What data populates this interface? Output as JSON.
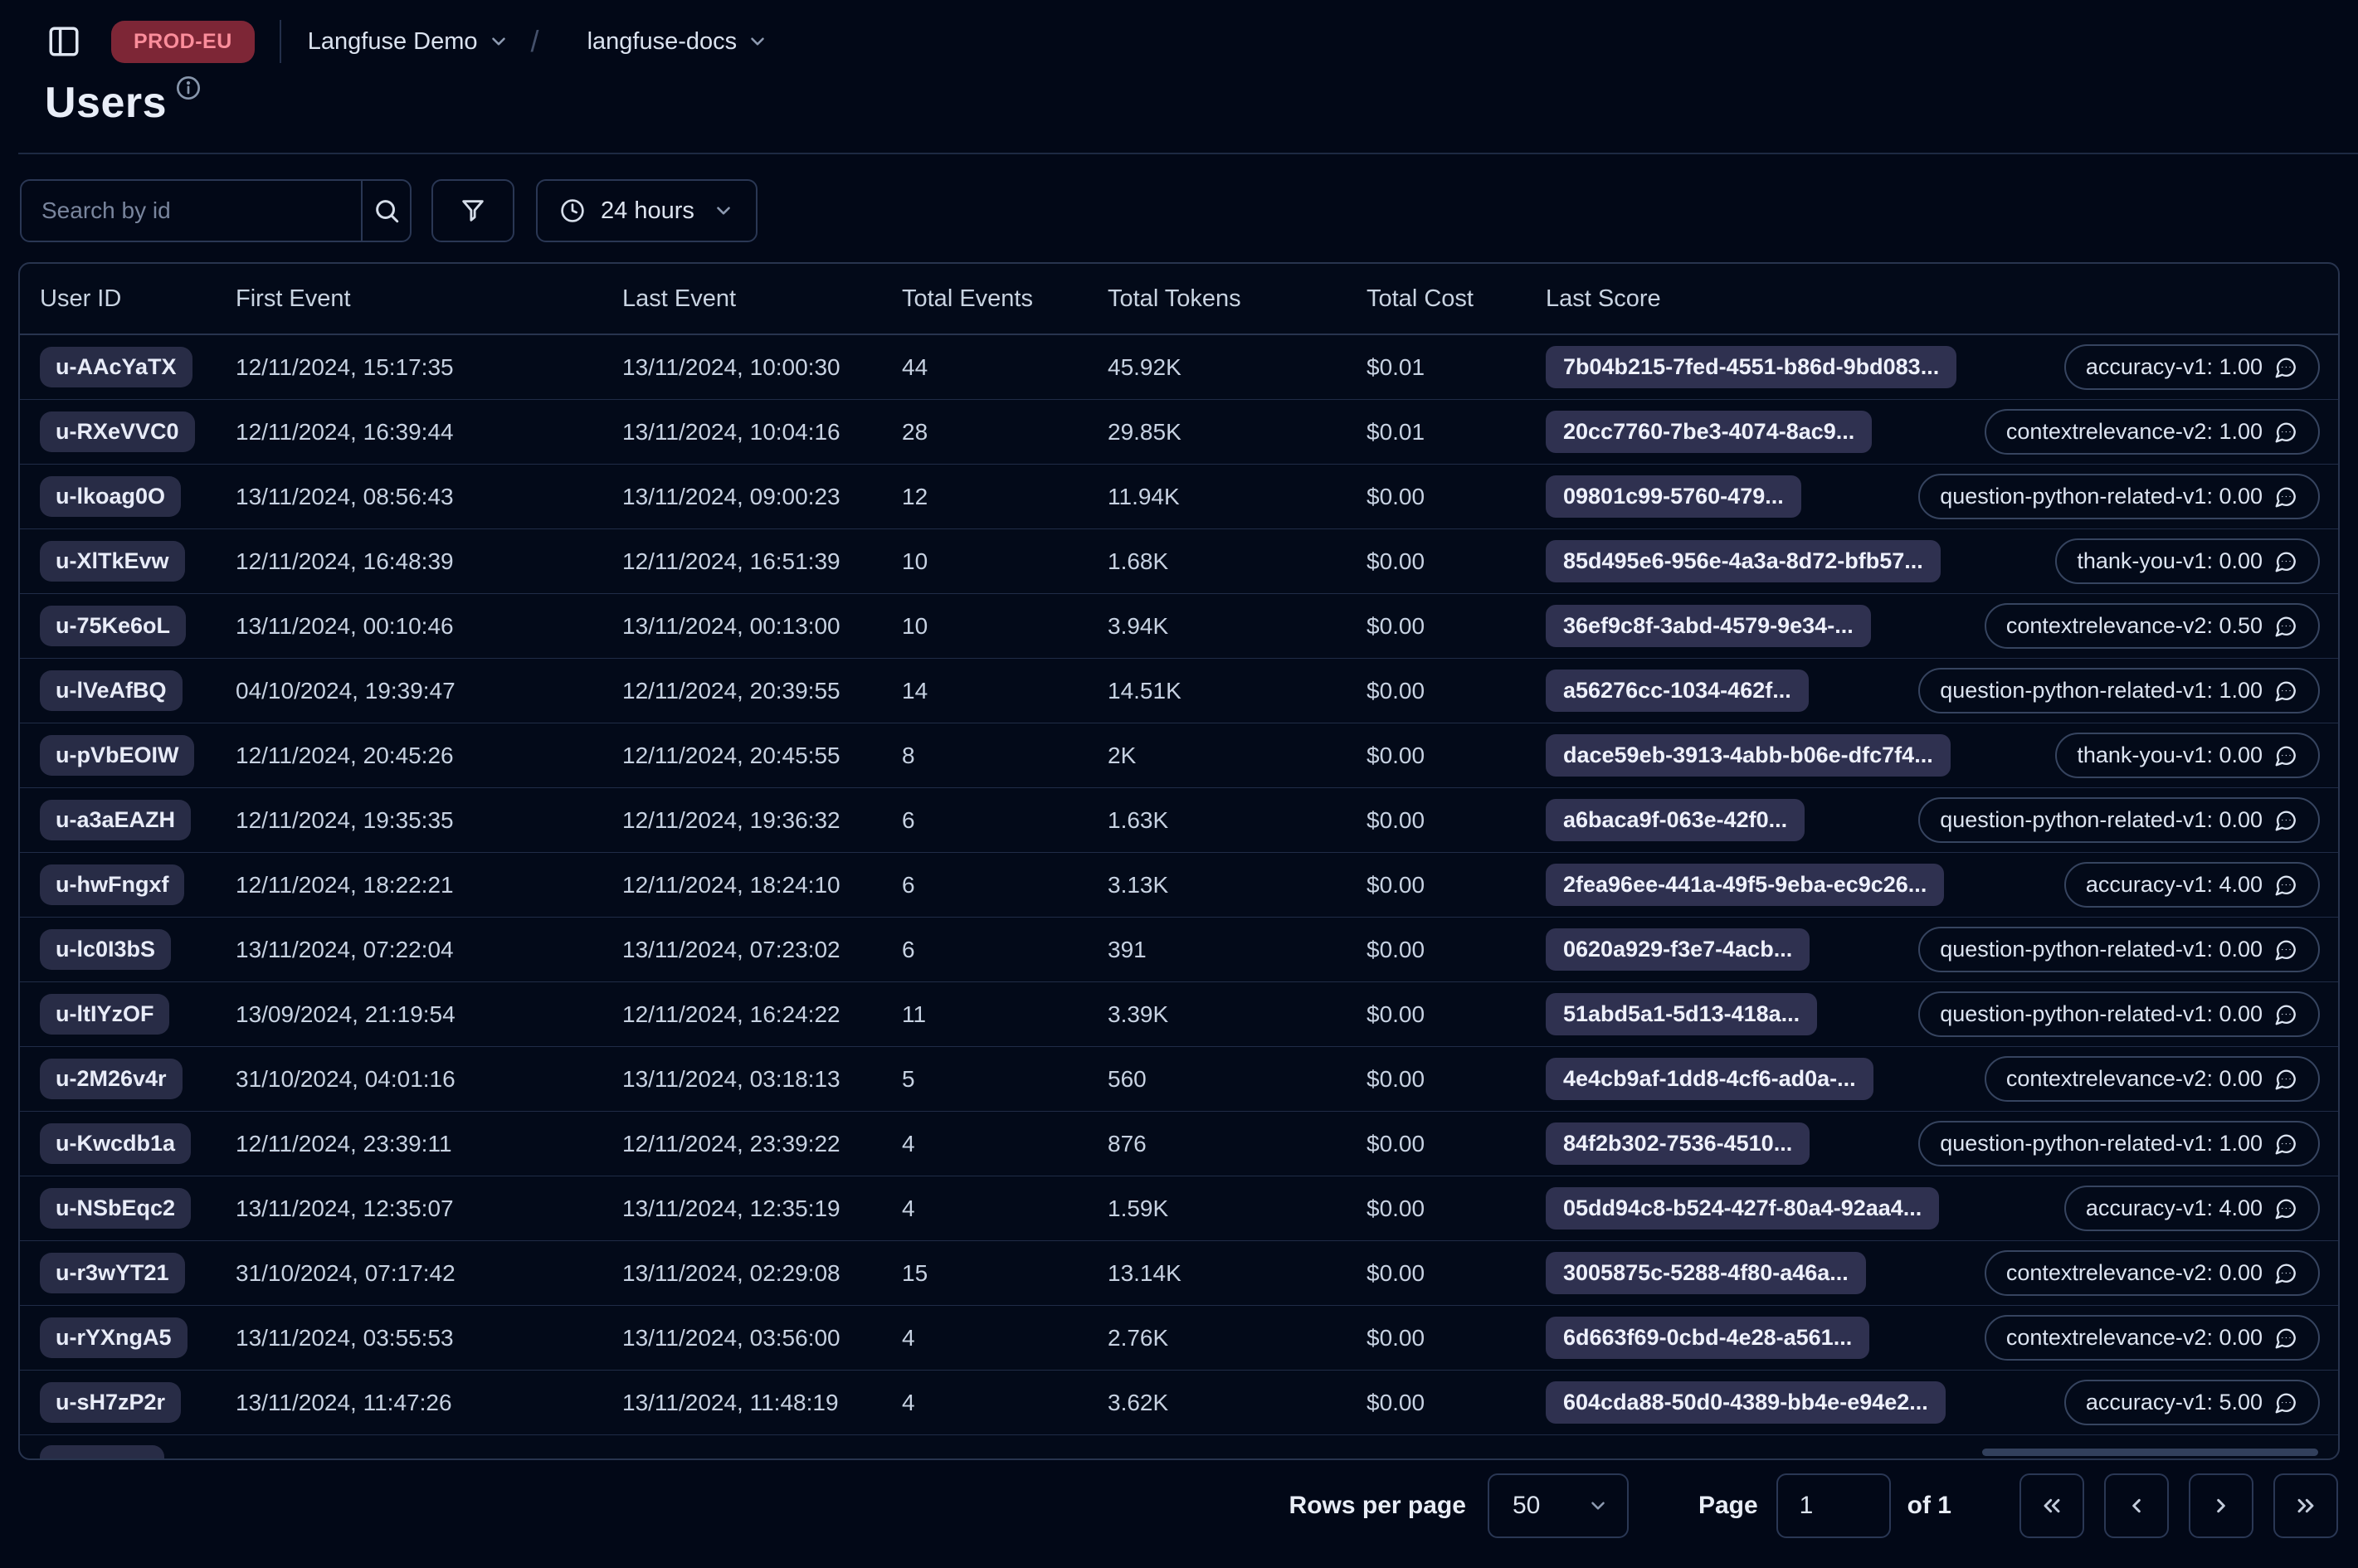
{
  "topbar": {
    "env_badge": "PROD-EU",
    "org": "Langfuse Demo",
    "separator": "/",
    "project": "langfuse-docs"
  },
  "page": {
    "title": "Users"
  },
  "toolbar": {
    "search_placeholder": "Search by id",
    "time_range": "24 hours"
  },
  "table": {
    "columns": [
      "User ID",
      "First Event",
      "Last Event",
      "Total Events",
      "Total Tokens",
      "Total Cost",
      "Last Score"
    ],
    "rows": [
      {
        "user_id": "u-AAcYaTX",
        "first_event": "12/11/2024, 15:17:35",
        "last_event": "13/11/2024, 10:00:30",
        "total_events": "44",
        "total_tokens": "45.92K",
        "total_cost": "$0.01",
        "trace_id": "7b04b215-7fed-4551-b86d-9bd083...",
        "score": "accuracy-v1: 1.00"
      },
      {
        "user_id": "u-RXeVVC0",
        "first_event": "12/11/2024, 16:39:44",
        "last_event": "13/11/2024, 10:04:16",
        "total_events": "28",
        "total_tokens": "29.85K",
        "total_cost": "$0.01",
        "trace_id": "20cc7760-7be3-4074-8ac9...",
        "score": "contextrelevance-v2: 1.00"
      },
      {
        "user_id": "u-lkoag0O",
        "first_event": "13/11/2024, 08:56:43",
        "last_event": "13/11/2024, 09:00:23",
        "total_events": "12",
        "total_tokens": "11.94K",
        "total_cost": "$0.00",
        "trace_id": "09801c99-5760-479...",
        "score": "question-python-related-v1: 0.00"
      },
      {
        "user_id": "u-XlTkEvw",
        "first_event": "12/11/2024, 16:48:39",
        "last_event": "12/11/2024, 16:51:39",
        "total_events": "10",
        "total_tokens": "1.68K",
        "total_cost": "$0.00",
        "trace_id": "85d495e6-956e-4a3a-8d72-bfb57...",
        "score": "thank-you-v1: 0.00"
      },
      {
        "user_id": "u-75Ke6oL",
        "first_event": "13/11/2024, 00:10:46",
        "last_event": "13/11/2024, 00:13:00",
        "total_events": "10",
        "total_tokens": "3.94K",
        "total_cost": "$0.00",
        "trace_id": "36ef9c8f-3abd-4579-9e34-...",
        "score": "contextrelevance-v2: 0.50"
      },
      {
        "user_id": "u-lVeAfBQ",
        "first_event": "04/10/2024, 19:39:47",
        "last_event": "12/11/2024, 20:39:55",
        "total_events": "14",
        "total_tokens": "14.51K",
        "total_cost": "$0.00",
        "trace_id": "a56276cc-1034-462f...",
        "score": "question-python-related-v1: 1.00"
      },
      {
        "user_id": "u-pVbEOIW",
        "first_event": "12/11/2024, 20:45:26",
        "last_event": "12/11/2024, 20:45:55",
        "total_events": "8",
        "total_tokens": "2K",
        "total_cost": "$0.00",
        "trace_id": "dace59eb-3913-4abb-b06e-dfc7f4...",
        "score": "thank-you-v1: 0.00"
      },
      {
        "user_id": "u-a3aEAZH",
        "first_event": "12/11/2024, 19:35:35",
        "last_event": "12/11/2024, 19:36:32",
        "total_events": "6",
        "total_tokens": "1.63K",
        "total_cost": "$0.00",
        "trace_id": "a6baca9f-063e-42f0...",
        "score": "question-python-related-v1: 0.00"
      },
      {
        "user_id": "u-hwFngxf",
        "first_event": "12/11/2024, 18:22:21",
        "last_event": "12/11/2024, 18:24:10",
        "total_events": "6",
        "total_tokens": "3.13K",
        "total_cost": "$0.00",
        "trace_id": "2fea96ee-441a-49f5-9eba-ec9c26...",
        "score": "accuracy-v1: 4.00"
      },
      {
        "user_id": "u-lc0I3bS",
        "first_event": "13/11/2024, 07:22:04",
        "last_event": "13/11/2024, 07:23:02",
        "total_events": "6",
        "total_tokens": "391",
        "total_cost": "$0.00",
        "trace_id": "0620a929-f3e7-4acb...",
        "score": "question-python-related-v1: 0.00"
      },
      {
        "user_id": "u-ltIYzOF",
        "first_event": "13/09/2024, 21:19:54",
        "last_event": "12/11/2024, 16:24:22",
        "total_events": "11",
        "total_tokens": "3.39K",
        "total_cost": "$0.00",
        "trace_id": "51abd5a1-5d13-418a...",
        "score": "question-python-related-v1: 0.00"
      },
      {
        "user_id": "u-2M26v4r",
        "first_event": "31/10/2024, 04:01:16",
        "last_event": "13/11/2024, 03:18:13",
        "total_events": "5",
        "total_tokens": "560",
        "total_cost": "$0.00",
        "trace_id": "4e4cb9af-1dd8-4cf6-ad0a-...",
        "score": "contextrelevance-v2: 0.00"
      },
      {
        "user_id": "u-Kwcdb1a",
        "first_event": "12/11/2024, 23:39:11",
        "last_event": "12/11/2024, 23:39:22",
        "total_events": "4",
        "total_tokens": "876",
        "total_cost": "$0.00",
        "trace_id": "84f2b302-7536-4510...",
        "score": "question-python-related-v1: 1.00"
      },
      {
        "user_id": "u-NSbEqc2",
        "first_event": "13/11/2024, 12:35:07",
        "last_event": "13/11/2024, 12:35:19",
        "total_events": "4",
        "total_tokens": "1.59K",
        "total_cost": "$0.00",
        "trace_id": "05dd94c8-b524-427f-80a4-92aa4...",
        "score": "accuracy-v1: 4.00"
      },
      {
        "user_id": "u-r3wYT21",
        "first_event": "31/10/2024, 07:17:42",
        "last_event": "13/11/2024, 02:29:08",
        "total_events": "15",
        "total_tokens": "13.14K",
        "total_cost": "$0.00",
        "trace_id": "3005875c-5288-4f80-a46a...",
        "score": "contextrelevance-v2: 0.00"
      },
      {
        "user_id": "u-rYXngA5",
        "first_event": "13/11/2024, 03:55:53",
        "last_event": "13/11/2024, 03:56:00",
        "total_events": "4",
        "total_tokens": "2.76K",
        "total_cost": "$0.00",
        "trace_id": "6d663f69-0cbd-4e28-a561...",
        "score": "contextrelevance-v2: 0.00"
      },
      {
        "user_id": "u-sH7zP2r",
        "first_event": "13/11/2024, 11:47:26",
        "last_event": "13/11/2024, 11:48:19",
        "total_events": "4",
        "total_tokens": "3.62K",
        "total_cost": "$0.00",
        "trace_id": "604cda88-50d0-4389-bb4e-e94e2...",
        "score": "accuracy-v1: 5.00"
      },
      {
        "user_id": "",
        "first_event": "",
        "last_event": "",
        "total_events": "",
        "total_tokens": "",
        "total_cost": "",
        "trace_id": "",
        "score": "",
        "partial": true
      }
    ]
  },
  "pagination": {
    "rows_per_page_label": "Rows per page",
    "rows_per_page": "50",
    "page_label": "Page",
    "page_value": "1",
    "of_label": "of 1"
  },
  "colors": {
    "background": "#020817",
    "env_badge_bg": "#7d2636",
    "env_badge_text": "#fb8d9b",
    "user_id_badge_bg": "#282c46",
    "trace_badge_bg": "#2f3150",
    "border": "#2a3754"
  }
}
